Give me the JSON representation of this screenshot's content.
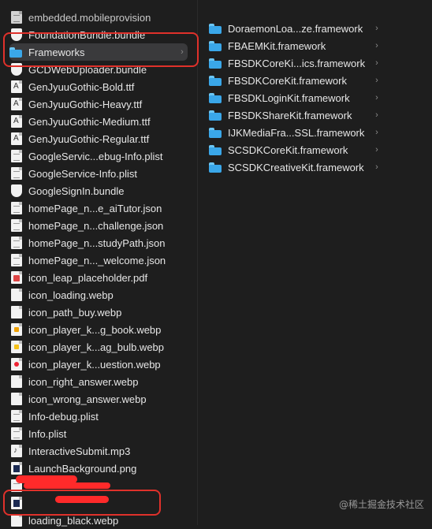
{
  "left_column": {
    "items": [
      {
        "label": "embedded.mobileprovision",
        "icon": "document-icon"
      },
      {
        "label": "FoundationBundle.bundle",
        "icon": "bundle-icon"
      },
      {
        "label": "Frameworks",
        "icon": "folder-icon",
        "selected": true,
        "chevron": "›"
      },
      {
        "label": "GCDWebUploader.bundle",
        "icon": "bundle-icon"
      },
      {
        "label": "GenJyuuGothic-Bold.ttf",
        "icon": "font-file-icon"
      },
      {
        "label": "GenJyuuGothic-Heavy.ttf",
        "icon": "font-file-icon"
      },
      {
        "label": "GenJyuuGothic-Medium.ttf",
        "icon": "font-file-icon"
      },
      {
        "label": "GenJyuuGothic-Regular.ttf",
        "icon": "font-file-icon"
      },
      {
        "label": "GoogleServic...ebug-Info.plist",
        "icon": "plist-file-icon"
      },
      {
        "label": "GoogleService-Info.plist",
        "icon": "plist-file-icon"
      },
      {
        "label": "GoogleSignIn.bundle",
        "icon": "bundle-icon"
      },
      {
        "label": "homePage_n...e_aiTutor.json",
        "icon": "json-file-icon"
      },
      {
        "label": "homePage_n...challenge.json",
        "icon": "json-file-icon"
      },
      {
        "label": "homePage_n...studyPath.json",
        "icon": "json-file-icon"
      },
      {
        "label": "homePage_n..._welcome.json",
        "icon": "json-file-icon"
      },
      {
        "label": "icon_leap_placeholder.pdf",
        "icon": "pdf-file-icon"
      },
      {
        "label": "icon_loading.webp",
        "icon": "image-file-icon"
      },
      {
        "label": "icon_path_buy.webp",
        "icon": "image-file-icon"
      },
      {
        "label": "icon_player_k...g_book.webp",
        "icon": "image-file-icon"
      },
      {
        "label": "icon_player_k...ag_bulb.webp",
        "icon": "image-file-icon"
      },
      {
        "label": "icon_player_k...uestion.webp",
        "icon": "image-file-icon"
      },
      {
        "label": "icon_right_answer.webp",
        "icon": "image-file-icon"
      },
      {
        "label": "icon_wrong_answer.webp",
        "icon": "image-file-icon"
      },
      {
        "label": "Info-debug.plist",
        "icon": "plist-file-icon"
      },
      {
        "label": "Info.plist",
        "icon": "plist-file-icon"
      },
      {
        "label": "InteractiveSubmit.mp3",
        "icon": "audio-file-icon"
      },
      {
        "label": "LaunchBackground.png",
        "icon": "image-file-icon"
      },
      {
        "label": "",
        "icon": "document-icon",
        "redacted": true
      },
      {
        "label": "",
        "icon": "document-icon",
        "redacted": true
      },
      {
        "label": "loading_black.webp",
        "icon": "image-file-icon"
      }
    ]
  },
  "middle_column": {
    "items": [
      {
        "label": "DoraemonLoa...ze.framework",
        "chevron": "›"
      },
      {
        "label": "FBAEMKit.framework",
        "chevron": "›"
      },
      {
        "label": "FBSDKCoreKi...ics.framework",
        "chevron": "›"
      },
      {
        "label": "FBSDKCoreKit.framework",
        "chevron": "›"
      },
      {
        "label": "FBSDKLoginKit.framework",
        "chevron": "›"
      },
      {
        "label": "FBSDKShareKit.framework",
        "chevron": "›"
      },
      {
        "label": "IJKMediaFra...SSL.framework",
        "chevron": "›"
      },
      {
        "label": "SCSDKCoreKit.framework",
        "chevron": "›"
      },
      {
        "label": "SCSDKCreativeKit.framework",
        "chevron": "›"
      }
    ]
  },
  "watermark": "@稀土掘金技术社区",
  "colors": {
    "background": "#1e1e1e",
    "selection": "#3a3a3c",
    "annotation_red": "#e0312b",
    "folder_blue": "#3aa7e9"
  }
}
